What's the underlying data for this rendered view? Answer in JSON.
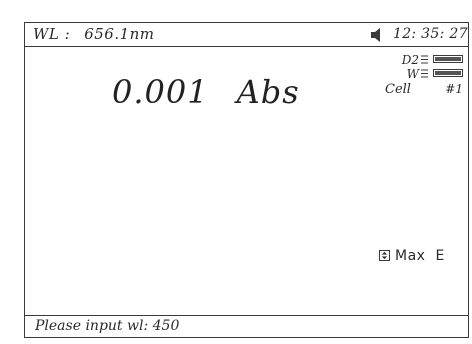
{
  "status_bar": {
    "wl_label": "WL :",
    "wl_value": "656.1nm",
    "speaker_icon": "speaker-icon",
    "time": "12: 35: 27"
  },
  "reading": {
    "value": "0.001",
    "unit": "Abs"
  },
  "lamps": {
    "d2_label": "D2",
    "d2_level": 1.0,
    "w_label": "W",
    "w_level": 1.0,
    "cell_label": "Cell",
    "cell_number": "#1"
  },
  "mode": {
    "icon": "up-down-arrow-icon",
    "label": "Max",
    "suffix": "E"
  },
  "prompt": {
    "text": "Please input wl: 450"
  },
  "colors": {
    "foreground": "#2a2a2a",
    "border": "#3a3a3a",
    "background": "#ffffff"
  }
}
